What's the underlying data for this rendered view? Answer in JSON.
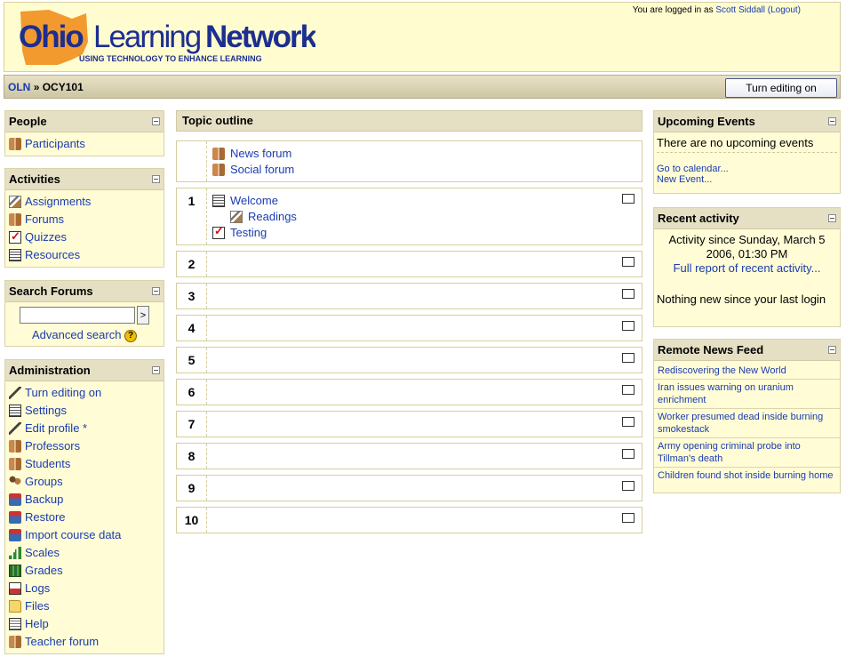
{
  "header": {
    "logo": {
      "line1_ohio": "Ohio",
      "line1_learning": "Learning",
      "line1_network": "Network",
      "tagline": "USING TECHNOLOGY TO ENHANCE LEARNING",
      "colors": {
        "ohio_shape": "#f29a2e",
        "text_blue": "#1c2e8f"
      }
    },
    "login_prefix": "You are logged in as",
    "user_name": "Scott Siddall",
    "logout_label": "(Logout)"
  },
  "navbar": {
    "breadcrumb_root": "OLN",
    "breadcrumb_sep": "»",
    "breadcrumb_current": "OCY101",
    "edit_button": "Turn editing on"
  },
  "left": {
    "people": {
      "title": "People",
      "items": [
        {
          "label": "Participants",
          "icon": "people-icon"
        }
      ]
    },
    "activities": {
      "title": "Activities",
      "items": [
        {
          "label": "Assignments",
          "icon": "assignment-icon"
        },
        {
          "label": "Forums",
          "icon": "forum-icon"
        },
        {
          "label": "Quizzes",
          "icon": "quiz-icon"
        },
        {
          "label": "Resources",
          "icon": "resource-icon"
        }
      ]
    },
    "search": {
      "title": "Search Forums",
      "input_value": "",
      "go_label": ">",
      "advanced_label": "Advanced search",
      "help_icon": "?"
    },
    "admin": {
      "title": "Administration",
      "items": [
        {
          "label": "Turn editing on",
          "icon": "edit-icon"
        },
        {
          "label": "Settings",
          "icon": "settings-icon"
        },
        {
          "label": "Edit profile *",
          "icon": "edit-profile-icon"
        },
        {
          "label": "Professors",
          "icon": "professors-icon"
        },
        {
          "label": "Students",
          "icon": "students-icon"
        },
        {
          "label": "Groups",
          "icon": "groups-icon"
        },
        {
          "label": "Backup",
          "icon": "backup-icon"
        },
        {
          "label": "Restore",
          "icon": "restore-icon"
        },
        {
          "label": "Import course data",
          "icon": "import-icon"
        },
        {
          "label": "Scales",
          "icon": "scales-icon"
        },
        {
          "label": "Grades",
          "icon": "grades-icon"
        },
        {
          "label": "Logs",
          "icon": "logs-icon"
        },
        {
          "label": "Files",
          "icon": "folder-icon"
        },
        {
          "label": "Help",
          "icon": "help-icon"
        },
        {
          "label": "Teacher forum",
          "icon": "forum-icon"
        }
      ]
    }
  },
  "center": {
    "title": "Topic outline",
    "section0": [
      {
        "label": "News forum"
      },
      {
        "label": "Social forum"
      }
    ],
    "section1": {
      "number": "1",
      "items": [
        {
          "label": "Welcome"
        },
        {
          "label": "Readings"
        },
        {
          "label": "Testing"
        }
      ]
    },
    "numbers": [
      "2",
      "3",
      "4",
      "5",
      "6",
      "7",
      "8",
      "9",
      "10"
    ]
  },
  "right": {
    "events": {
      "title": "Upcoming Events",
      "empty": "There are no upcoming events",
      "calendar_link": "Go to calendar...",
      "new_event_link": "New Event..."
    },
    "recent": {
      "title": "Recent activity",
      "since": "Activity since Sunday, March 5 2006, 01:30 PM",
      "full_report": "Full report of recent activity...",
      "nothing_new": "Nothing new since your last login"
    },
    "news": {
      "title": "Remote News Feed",
      "items": [
        "Rediscovering the New World",
        "Iran issues warning on uranium enrichment",
        "Worker presumed dead inside burning smokestack",
        "Army opening criminal probe into Tillman's death",
        "Children found shot inside burning home"
      ]
    }
  }
}
